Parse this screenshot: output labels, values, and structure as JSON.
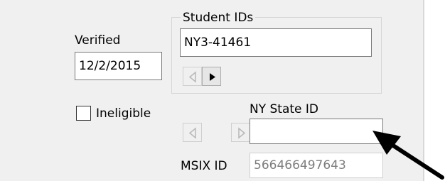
{
  "verified": {
    "label": "Verified",
    "value": "12/2/2015"
  },
  "student_ids": {
    "group_label": "Student IDs",
    "value": "NY3-41461",
    "prev_button": {
      "icon": "triangle-left-icon",
      "enabled": false
    },
    "next_button": {
      "icon": "triangle-right-icon",
      "enabled": true
    }
  },
  "ineligible": {
    "label": "Ineligible",
    "checked": false
  },
  "ny_state_id": {
    "label": "NY State ID",
    "value": "",
    "prev_button": {
      "icon": "triangle-left-icon",
      "enabled": false
    },
    "next_button": {
      "icon": "triangle-right-icon",
      "enabled": false
    }
  },
  "msix_id": {
    "label": "MSIX ID",
    "value": "566466497643"
  },
  "annotation": {
    "icon": "pointer-arrow-icon",
    "color": "#000000"
  }
}
